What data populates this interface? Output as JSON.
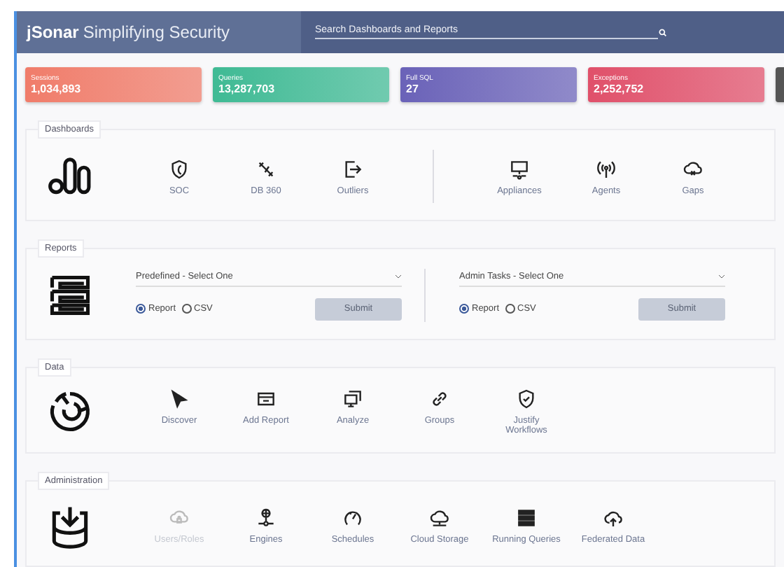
{
  "header": {
    "brand_bold": "jSonar",
    "brand_rest": "Simplifying Security",
    "search": {
      "placeholder": "Search Dashboards and Reports"
    }
  },
  "stats": [
    {
      "label": "Sessions",
      "value": "1,034,893",
      "color": "#f07c6a"
    },
    {
      "label": "Queries",
      "value": "13,287,703",
      "color": "#3fba94"
    },
    {
      "label": "Full SQL",
      "value": "27",
      "color": "#6a62b8"
    },
    {
      "label": "Exceptions",
      "value": "2,252,752",
      "color": "#e0506a"
    }
  ],
  "dashboards": {
    "title": "Dashboards",
    "groups": [
      [
        {
          "label": "SOC"
        },
        {
          "label": "DB 360"
        },
        {
          "label": "Outliers"
        }
      ],
      [
        {
          "label": "Appliances"
        },
        {
          "label": "Agents"
        },
        {
          "label": "Gaps"
        }
      ]
    ]
  },
  "reports": {
    "title": "Reports",
    "forms": [
      {
        "select": {
          "placeholder": "Predefined - Select One"
        },
        "options": [
          {
            "label": "Report",
            "selected": true
          },
          {
            "label": "CSV",
            "selected": false
          }
        ],
        "submit": {
          "label": "Submit",
          "disabled": true
        }
      },
      {
        "select": {
          "placeholder": "Admin Tasks - Select One"
        },
        "options": [
          {
            "label": "Report",
            "selected": true
          },
          {
            "label": "CSV",
            "selected": false
          }
        ],
        "submit": {
          "label": "Submit",
          "disabled": true
        }
      }
    ]
  },
  "data": {
    "title": "Data",
    "items": [
      {
        "label": "Discover",
        "disabled": false
      },
      {
        "label": "Add Report",
        "disabled": false
      },
      {
        "label": "Analyze",
        "disabled": false
      },
      {
        "label": "Groups",
        "disabled": false
      },
      {
        "label": "Justify Workflows",
        "disabled": false
      }
    ]
  },
  "administration": {
    "title": "Administration",
    "items": [
      {
        "label": "Users/Roles",
        "disabled": true
      },
      {
        "label": "Engines",
        "disabled": false
      },
      {
        "label": "Schedules",
        "disabled": false
      },
      {
        "label": "Cloud Storage",
        "disabled": false
      },
      {
        "label": "Running Queries",
        "disabled": false
      },
      {
        "label": "Federated Data",
        "disabled": false
      }
    ]
  }
}
